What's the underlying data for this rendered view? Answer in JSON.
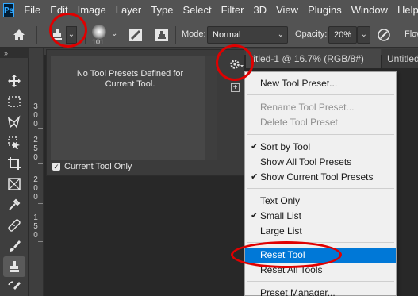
{
  "app": {
    "logo": "Ps"
  },
  "menubar": [
    "File",
    "Edit",
    "Image",
    "Layer",
    "Type",
    "Select",
    "Filter",
    "3D",
    "View",
    "Plugins",
    "Window",
    "Help"
  ],
  "options_bar": {
    "brush_size": "101",
    "mode_label": "Mode:",
    "mode_value": "Normal",
    "opacity_label": "Opacity:",
    "opacity_value": "20%",
    "flow_label": "Flow"
  },
  "ruler": {
    "groups": [
      [
        "3",
        "0",
        "0"
      ],
      [
        "2",
        "5",
        "0"
      ],
      [
        "2",
        "0",
        "0"
      ],
      [
        "1",
        "5",
        "0"
      ]
    ]
  },
  "preset_panel": {
    "empty_message": "No Tool Presets Defined for Current Tool.",
    "current_tool_only_label": "Current Tool Only",
    "current_tool_only_checked": true
  },
  "doc_tabs": [
    "titled-1 @ 16.7% (RGB/8#)",
    "Untitled"
  ],
  "context_menu": {
    "items": [
      {
        "label": "New Tool Preset...",
        "enabled": true,
        "checked": false
      },
      {
        "label": "Rename Tool Preset...",
        "enabled": false,
        "checked": false
      },
      {
        "label": "Delete Tool Preset",
        "enabled": false,
        "checked": false
      },
      {
        "label": "Sort by Tool",
        "enabled": true,
        "checked": true
      },
      {
        "label": "Show All Tool Presets",
        "enabled": true,
        "checked": false
      },
      {
        "label": "Show Current Tool Presets",
        "enabled": true,
        "checked": true
      },
      {
        "label": "Text Only",
        "enabled": true,
        "checked": false
      },
      {
        "label": "Small List",
        "enabled": true,
        "checked": true
      },
      {
        "label": "Large List",
        "enabled": true,
        "checked": false
      },
      {
        "label": "Reset Tool",
        "enabled": true,
        "checked": false,
        "highlighted": true
      },
      {
        "label": "Reset All Tools",
        "enabled": true,
        "checked": false
      },
      {
        "label": "Preset Manager...",
        "enabled": true,
        "checked": false
      }
    ],
    "check_glyph": "✔"
  },
  "colors": {
    "highlight": "#0078d7",
    "annotation": "#e00000",
    "ui_bg": "#535353"
  }
}
